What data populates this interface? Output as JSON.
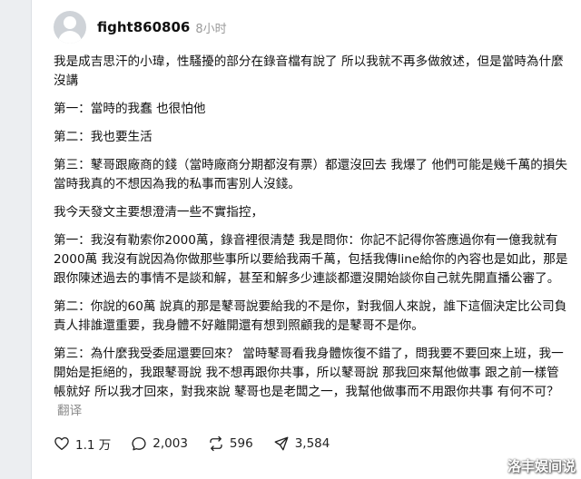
{
  "post": {
    "username": "fight860806",
    "time": "8小时",
    "paragraphs": [
      "我是成吉思汗的小瑋，性騷擾的部分在錄音檔有說了 所以我就不再多做敘述，但是當時為什麼沒講",
      "第一：當時的我蠢 也很怕他",
      "第二：我也要生活",
      "第三：鼕哥跟廠商的錢（當時廠商分期都沒有票）都還沒回去 我爆了 他們可能是幾千萬的損失 當時我真的不想因為我的私事而害別人沒錢。",
      "我今天發文主要想澄清一些不實指控，",
      "第一：我沒有勒索你2000萬，錄音裡很清楚 我是問你：你記不記得你答應過你有一億我就有2000萬 我沒有說因為你做那些事所以要給我兩千萬，包括我傳line給你的內容也是如此，那是跟你陳述過去的事情不是談和解，甚至和解多少連談都還沒開始談你自己就先開直播公審了。",
      "第二：你說的60萬 說真的那是鼕哥說要給我的不是你，對我個人來說，誰下這個決定比公司負責人排誰還重要，我身體不好離開還有想到照顧我的是鼕哥不是你。",
      "第三：為什麼我受委屈還要回來？ 當時鼕哥看我身體恢復不錯了，問我要不要回來上班，我一開始是拒絕的，我跟鼕哥說 我不想再跟你共事，所以鼕哥說 那我回來幫他做事 跟之前一樣管帳就好 所以我才回來，對我來說 鼕哥也是老闆之一，我幫他做事而不用跟你共事 有何不可？"
    ],
    "translate_label": "翻译"
  },
  "actions": {
    "likes": "1.1 万",
    "comments": "2,003",
    "reposts": "596",
    "shares": "3,584"
  },
  "watermark": "洛丰娱间说"
}
